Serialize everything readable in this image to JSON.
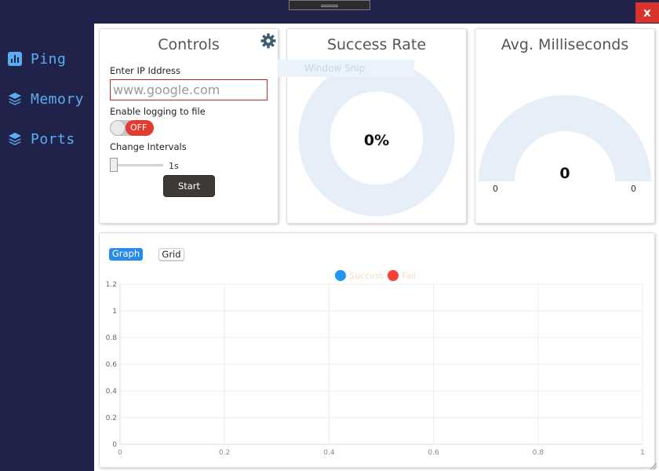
{
  "window": {
    "close_label": "x"
  },
  "sidebar": {
    "items": [
      {
        "label": "Ping",
        "icon": "bar-chart-icon"
      },
      {
        "label": "Memory",
        "icon": "layers-icon"
      },
      {
        "label": "Ports",
        "icon": "layers-icon"
      }
    ]
  },
  "controls": {
    "title": "Controls",
    "ip_label": "Enter IP Iddress",
    "ip_placeholder": "www.google.com",
    "logging_label": "Enable logging to file",
    "logging_state": "OFF",
    "interval_label": "Change Intervals",
    "interval_value": "1s",
    "start_label": "Start"
  },
  "success_rate": {
    "title": "Success Rate",
    "value": "0%",
    "ghost_text": "Window Snip"
  },
  "avg_ms": {
    "title": "Avg. Milliseconds",
    "value": "0",
    "min": "0",
    "max": "0"
  },
  "graph": {
    "tabs": [
      {
        "label": "Graph",
        "active": true
      },
      {
        "label": "Grid",
        "active": false
      }
    ]
  },
  "chart_data": {
    "type": "line",
    "series": [
      {
        "name": "Success",
        "color": "#2196f3",
        "x": [],
        "y": []
      },
      {
        "name": "Fail",
        "color": "#f44336",
        "x": [],
        "y": []
      }
    ],
    "xlim": [
      0,
      1
    ],
    "ylim": [
      0,
      1.2
    ],
    "x_ticks": [
      "0",
      "0.2",
      "0.4",
      "0.6",
      "0.8",
      "1"
    ],
    "y_ticks": [
      "0",
      "0.2",
      "0.4",
      "0.6",
      "0.8",
      "1",
      "1.2"
    ],
    "grid": true,
    "legend": "top"
  },
  "colors": {
    "sidebar_bg": "#21224a",
    "nav_text": "#5aaef0",
    "accent": "#2a8ae8",
    "toggle_off": "#e33b2f",
    "gauge_bg": "#e6eef8"
  }
}
